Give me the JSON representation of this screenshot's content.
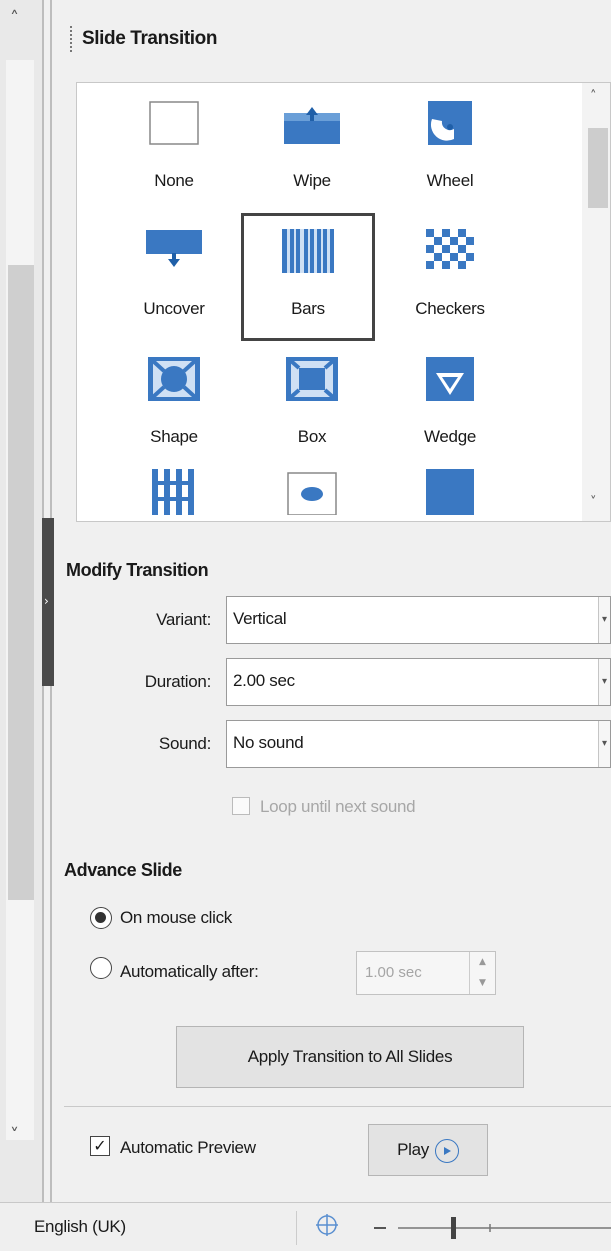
{
  "panel": {
    "title": "Slide Transition"
  },
  "gallery": {
    "items": [
      {
        "label": "None",
        "icon": "none-icon"
      },
      {
        "label": "Wipe",
        "icon": "wipe-icon"
      },
      {
        "label": "Wheel",
        "icon": "wheel-icon"
      },
      {
        "label": "Uncover",
        "icon": "uncover-icon"
      },
      {
        "label": "Bars",
        "icon": "bars-icon",
        "selected": true
      },
      {
        "label": "Checkers",
        "icon": "checkers-icon"
      },
      {
        "label": "Shape",
        "icon": "shape-icon"
      },
      {
        "label": "Box",
        "icon": "box-icon"
      },
      {
        "label": "Wedge",
        "icon": "wedge-icon"
      },
      {
        "label": "",
        "icon": "venetian-icon"
      },
      {
        "label": "",
        "icon": "iris-icon"
      },
      {
        "label": "",
        "icon": "fade-icon"
      }
    ]
  },
  "modify": {
    "heading": "Modify Transition",
    "variant_label": "Variant:",
    "variant_value": "Vertical",
    "duration_label": "Duration:",
    "duration_value": "2.00 sec",
    "sound_label": "Sound:",
    "sound_value": "No sound",
    "loop_label": "Loop until next sound"
  },
  "advance": {
    "heading": "Advance Slide",
    "on_click_label": "On mouse click",
    "auto_label": "Automatically after:",
    "auto_value": "1.00 sec",
    "apply_all_label": "Apply Transition to All Slides"
  },
  "footer": {
    "auto_preview_label": "Automatic Preview",
    "play_label": "Play"
  },
  "status": {
    "language": "English (UK)"
  },
  "colors": {
    "accent": "#3a78c2"
  }
}
